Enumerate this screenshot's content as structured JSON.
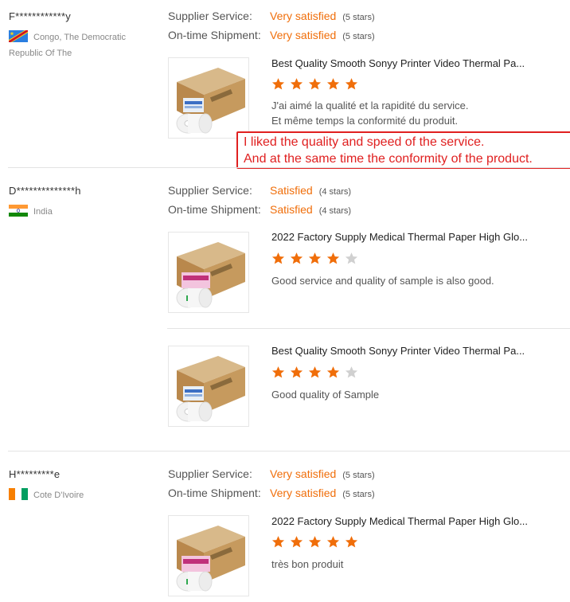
{
  "labels": {
    "supplier_service": "Supplier Service:",
    "on_time_shipment": "On-time Shipment:"
  },
  "colors": {
    "accent": "#f06e0a",
    "star_empty": "#d0d0d0",
    "translation": "#e02020"
  },
  "reviews": [
    {
      "user": "F************y",
      "country": "Congo, The Democratic Republic Of The",
      "flag": "congo-dr-flag",
      "supplier_service": {
        "value": "Very satisfied",
        "stars": "(5 stars)"
      },
      "on_time_shipment": {
        "value": "Very satisfied",
        "stars": "(5 stars)"
      },
      "products": [
        {
          "title": "Best Quality Smooth Sonyy Printer Video Thermal Pa...",
          "rating": 5,
          "comment_line1": "J'ai aimé la qualité  et la rapidité du service.",
          "comment_line2": "Et même temps la conformité du produit.",
          "translation_line1": "I liked the quality and speed of the service.",
          "translation_line2": "And at the same time the conformity of the product."
        }
      ]
    },
    {
      "user": "D**************h",
      "country": "India",
      "flag": "india-flag",
      "supplier_service": {
        "value": "Satisfied",
        "stars": "(4 stars)"
      },
      "on_time_shipment": {
        "value": "Satisfied",
        "stars": "(4 stars)"
      },
      "products": [
        {
          "title": "2022 Factory Supply Medical Thermal Paper High Glo...",
          "rating": 4,
          "comment": "Good service and quality of sample is also good."
        },
        {
          "title": "Best Quality Smooth Sonyy Printer Video Thermal Pa...",
          "rating": 4,
          "comment": "Good quality of Sample"
        }
      ]
    },
    {
      "user": "H*********e",
      "country": "Cote D'Ivoire",
      "flag": "cote-divoire-flag",
      "supplier_service": {
        "value": "Very satisfied",
        "stars": "(5 stars)"
      },
      "on_time_shipment": {
        "value": "Very satisfied",
        "stars": "(5 stars)"
      },
      "products": [
        {
          "title": "2022 Factory Supply Medical Thermal Paper High Glo...",
          "rating": 5,
          "comment": "très bon produit"
        }
      ]
    }
  ]
}
